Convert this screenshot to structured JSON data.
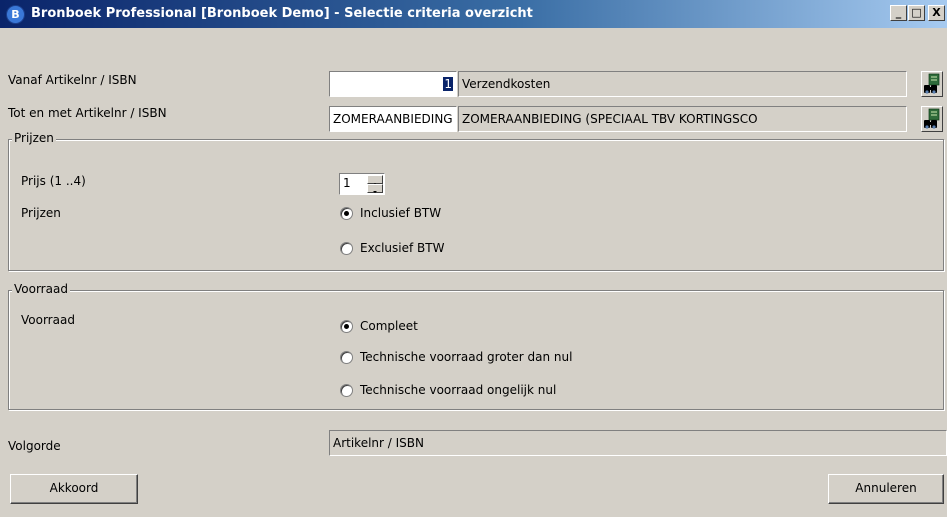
{
  "window": {
    "app_icon_letter": "B",
    "title": "Bronboek Professional [Bronboek Demo] - Selectie criteria overzicht",
    "controls": {
      "minimize": "_",
      "maximize": "□",
      "close": "X"
    }
  },
  "article_from": {
    "label": "Vanaf Artikelnr / ISBN",
    "value": "1",
    "description": "Verzendkosten",
    "lookup_icon": "binoculars-icon"
  },
  "article_to": {
    "label": "Tot en met Artikelnr / ISBN",
    "value": "ZOMERAANBIEDING",
    "description": "ZOMERAANBIEDING (SPECIAAL TBV KORTINGSCO",
    "lookup_icon": "binoculars-icon"
  },
  "prices_group": {
    "legend": "Prijzen",
    "price_label": "Prijs (1 ..4)",
    "price_value": "1",
    "prices_label": "Prijzen",
    "options": [
      {
        "label": "Inclusief BTW",
        "selected": true
      },
      {
        "label": "Exclusief BTW",
        "selected": false
      }
    ]
  },
  "stock_group": {
    "legend": "Voorraad",
    "stock_label": "Voorraad",
    "options": [
      {
        "label": "Compleet",
        "selected": true
      },
      {
        "label": "Technische voorraad groter dan nul",
        "selected": false
      },
      {
        "label": "Technische voorraad ongelijk nul",
        "selected": false
      }
    ]
  },
  "order": {
    "label": "Volgorde",
    "value": "Artikelnr / ISBN"
  },
  "buttons": {
    "ok": "Akkoord",
    "cancel": "Annuleren"
  }
}
